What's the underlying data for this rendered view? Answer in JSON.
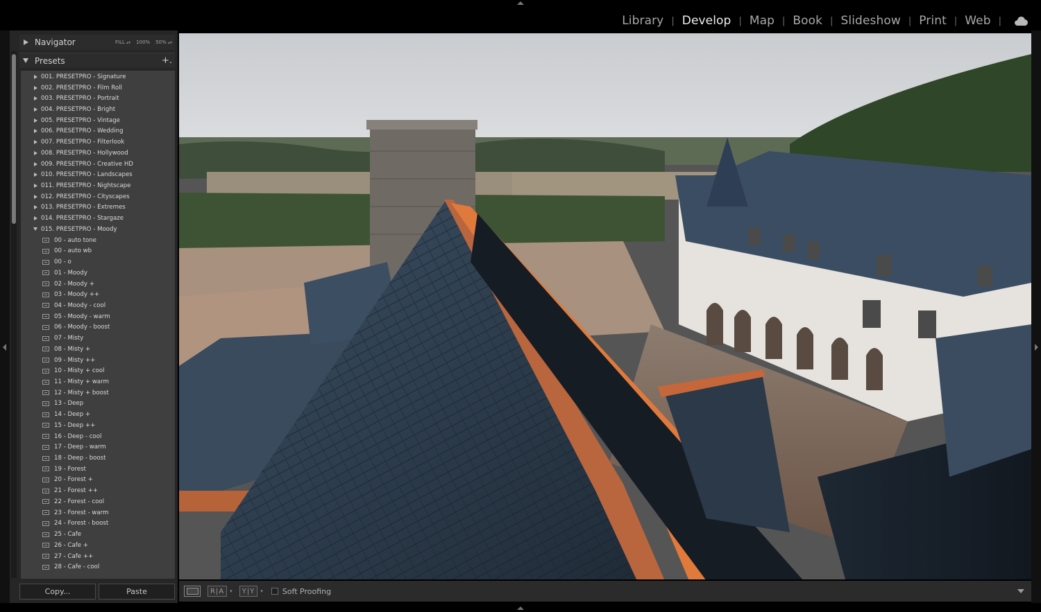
{
  "modules": [
    {
      "label": "Library",
      "active": false
    },
    {
      "label": "Develop",
      "active": true
    },
    {
      "label": "Map",
      "active": false
    },
    {
      "label": "Book",
      "active": false
    },
    {
      "label": "Slideshow",
      "active": false
    },
    {
      "label": "Print",
      "active": false
    },
    {
      "label": "Web",
      "active": false
    }
  ],
  "separator": "|",
  "navigator": {
    "title": "Navigator",
    "zoom_fill": "FILL",
    "zoom_100": "100%",
    "zoom_50": "50%",
    "zoom_arrows": "▴▾"
  },
  "presets": {
    "title": "Presets",
    "add_label": "+.",
    "items": [
      {
        "type": "group",
        "label": "001. PRESETPRO - Signature"
      },
      {
        "type": "group",
        "label": "002. PRESETPRO - Film Roll"
      },
      {
        "type": "group",
        "label": "003. PRESETPRO - Portrait"
      },
      {
        "type": "group",
        "label": "004. PRESETPRO - Bright"
      },
      {
        "type": "group",
        "label": "005. PRESETPRO - Vintage"
      },
      {
        "type": "group",
        "label": "006. PRESETPRO - Wedding"
      },
      {
        "type": "group",
        "label": "007. PRESETPRO - Filterlook"
      },
      {
        "type": "group",
        "label": "008. PRESETPRO - Hollywood"
      },
      {
        "type": "group",
        "label": "009. PRESETPRO - Creative HD"
      },
      {
        "type": "group",
        "label": "010. PRESETPRO - Landscapes"
      },
      {
        "type": "group",
        "label": "011. PRESETPRO - Nightscape"
      },
      {
        "type": "group",
        "label": "012. PRESETPRO - Cityscapes"
      },
      {
        "type": "group",
        "label": "013. PRESETPRO - Extremes"
      },
      {
        "type": "group",
        "label": "014. PRESETPRO - Stargaze"
      },
      {
        "type": "group-open",
        "label": "015. PRESETPRO - Moody"
      },
      {
        "type": "preset",
        "label": "00 - auto tone"
      },
      {
        "type": "preset",
        "label": "00 - auto wb"
      },
      {
        "type": "preset",
        "label": "00 - o"
      },
      {
        "type": "preset",
        "label": "01 - Moody"
      },
      {
        "type": "preset",
        "label": "02 - Moody +"
      },
      {
        "type": "preset",
        "label": "03 - Moody ++"
      },
      {
        "type": "preset",
        "label": "04 - Moody - cool"
      },
      {
        "type": "preset",
        "label": "05 - Moody - warm"
      },
      {
        "type": "preset",
        "label": "06 - Moody - boost"
      },
      {
        "type": "preset",
        "label": "07 - Misty"
      },
      {
        "type": "preset",
        "label": "08 - Misty +"
      },
      {
        "type": "preset",
        "label": "09 - Misty ++"
      },
      {
        "type": "preset",
        "label": "10 - Misty + cool"
      },
      {
        "type": "preset",
        "label": "11 - Misty + warm"
      },
      {
        "type": "preset",
        "label": "12 - Misty + boost"
      },
      {
        "type": "preset",
        "label": "13 - Deep"
      },
      {
        "type": "preset",
        "label": "14 - Deep +"
      },
      {
        "type": "preset",
        "label": "15 - Deep ++"
      },
      {
        "type": "preset",
        "label": "16 - Deep - cool"
      },
      {
        "type": "preset",
        "label": "17 - Deep - warm"
      },
      {
        "type": "preset",
        "label": "18 - Deep - boost"
      },
      {
        "type": "preset",
        "label": "19 - Forest"
      },
      {
        "type": "preset",
        "label": "20 - Forest +"
      },
      {
        "type": "preset",
        "label": "21 - Forest ++"
      },
      {
        "type": "preset",
        "label": "22 - Forest - cool"
      },
      {
        "type": "preset",
        "label": "23 - Forest - warm"
      },
      {
        "type": "preset",
        "label": "24 - Forest - boost"
      },
      {
        "type": "preset",
        "label": "25 - Cafe"
      },
      {
        "type": "preset",
        "label": "26 - Cafe +"
      },
      {
        "type": "preset",
        "label": "27 - Cafe ++"
      },
      {
        "type": "preset",
        "label": "28 - Cafe - cool"
      }
    ]
  },
  "buttons": {
    "copy": "Copy...",
    "paste": "Paste"
  },
  "toolbar": {
    "before_after_label": "R|A",
    "yy_label": "Y|Y",
    "soft_proofing": "Soft Proofing"
  },
  "icons": {
    "cloud": "cloud-icon",
    "collapse_top": "panel-collapse-top-icon",
    "collapse_bottom": "panel-collapse-bottom-icon",
    "collapse_left": "panel-collapse-left-icon",
    "collapse_right": "panel-collapse-right-icon"
  },
  "colors": {
    "panel_bg": "#262626",
    "list_bg": "#3f3f3f",
    "active_module": "#f0f0f0",
    "inactive_module": "#a9a9a9"
  }
}
